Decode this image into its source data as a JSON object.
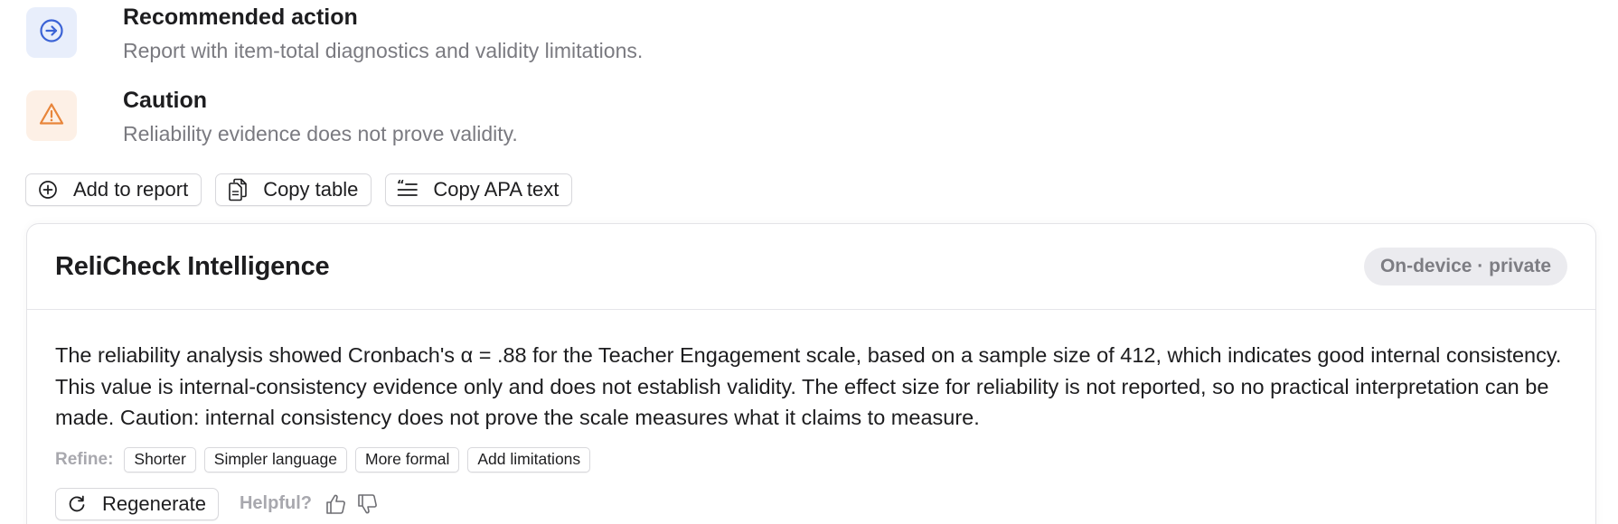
{
  "insights": [
    {
      "title": "Recommended action",
      "description": "Report with item-total diagnostics and validity limitations.",
      "icon": "arrow-circle-right-icon",
      "accent": "#3b63d6",
      "badge_bg": "#e8eefb"
    },
    {
      "title": "Caution",
      "description": "Reliability evidence does not prove validity.",
      "icon": "warning-triangle-icon",
      "accent": "#e8853a",
      "badge_bg": "#fdf0e6"
    }
  ],
  "actions": {
    "add_to_report": "Add to report",
    "copy_table": "Copy table",
    "copy_apa_text": "Copy APA text"
  },
  "intelligence": {
    "title": "ReliCheck Intelligence",
    "privacy_badge": "On-device · private",
    "summary": "The reliability analysis showed Cronbach's α = .88 for the Teacher Engagement scale, based on a sample size of 412, which indicates good internal consistency. This value is internal-consistency evidence only and does not establish validity. The effect size for reliability is not reported, so no practical interpretation can be made. Caution: internal consistency does not prove the scale measures what it claims to measure.",
    "refine_label": "Refine:",
    "refine_options": [
      "Shorter",
      "Simpler language",
      "More formal",
      "Add limitations"
    ],
    "regenerate_label": "Regenerate",
    "helpful_label": "Helpful?"
  }
}
